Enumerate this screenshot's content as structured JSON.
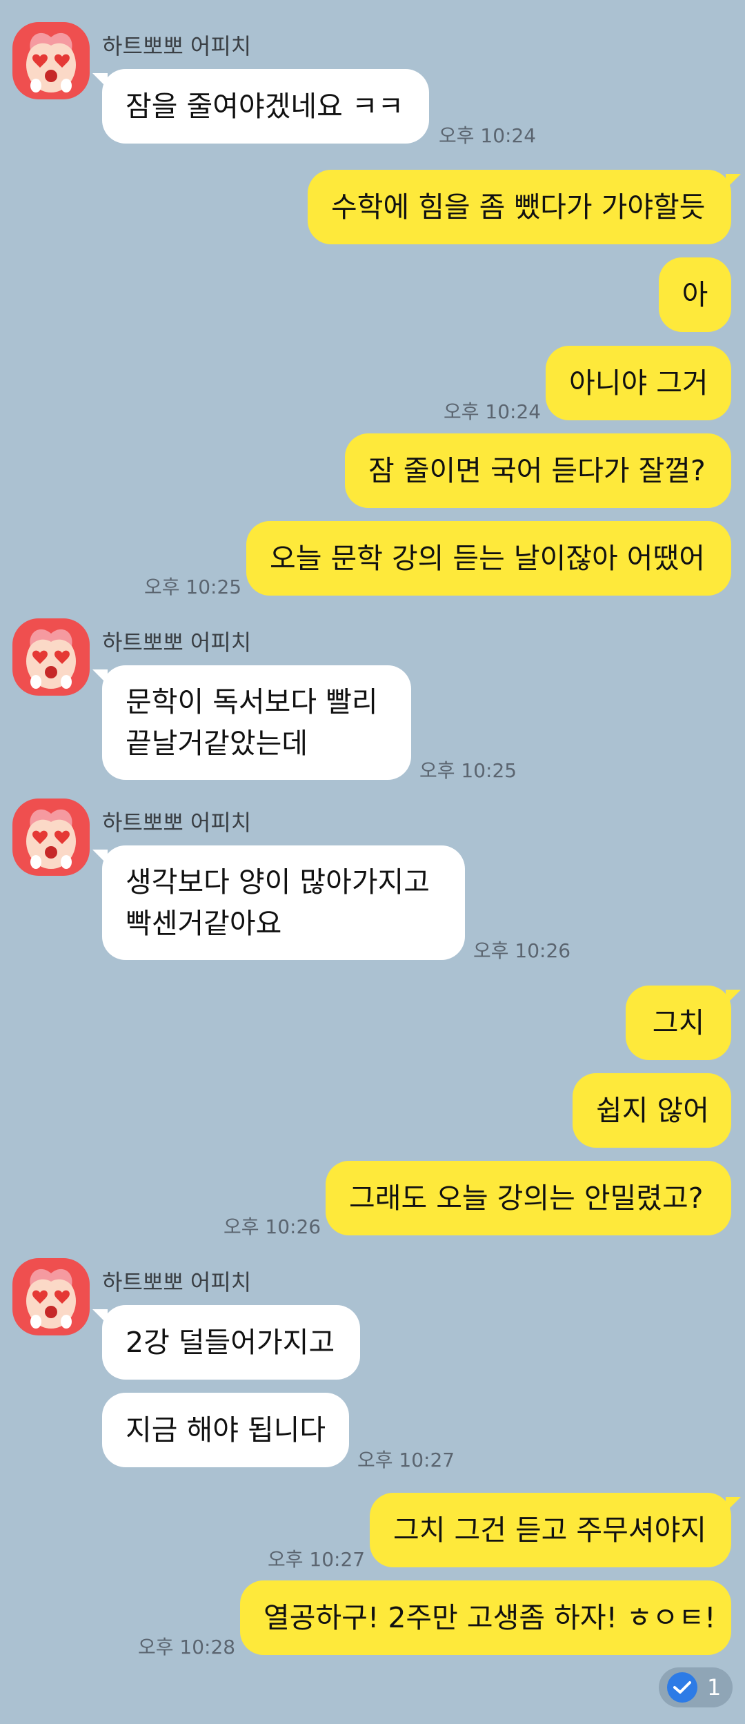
{
  "sender_name": "하트뽀뽀 어피치",
  "messages": [
    {
      "text": "잠을 줄여야겠네요 ㅋㅋ",
      "time": "오후 10:24"
    },
    {
      "text": "수학에 힘을 좀 뺐다가 가야할듯"
    },
    {
      "text": "아"
    },
    {
      "text": "아니야 그거",
      "time": "오후 10:24"
    },
    {
      "text": "잠 줄이면 국어 듣다가 잘껄?"
    },
    {
      "text": "오늘 문학 강의 듣는 날이잖아 어땠어",
      "time": "오후 10:25"
    },
    {
      "lines": [
        "문학이 독서보다 빨리",
        "끝날거같았는데"
      ],
      "time": "오후 10:25"
    },
    {
      "lines": [
        "생각보다 양이 많아가지고",
        "빡센거같아요"
      ],
      "time": "오후 10:26"
    },
    {
      "text": "그치"
    },
    {
      "text": "쉽지 않어"
    },
    {
      "text": "그래도 오늘 강의는 안밀렸고?",
      "time": "오후 10:26"
    },
    {
      "text": "2강 덜들어가지고"
    },
    {
      "text": "지금 해야 됩니다",
      "time": "오후 10:27"
    },
    {
      "text": "그치 그건 듣고 주무셔야지",
      "time": "오후 10:27"
    },
    {
      "text": "열공하구! 2주만 고생좀 하자! ㅎㅇㅌ!",
      "time": "오후 10:28"
    }
  ],
  "read_badge": {
    "icon": "check-circle-icon",
    "count": "1"
  },
  "colors": {
    "background": "#abc1d1",
    "incoming": "#ffffff",
    "outgoing": "#fee93b",
    "avatar": "#ef4f4f"
  }
}
